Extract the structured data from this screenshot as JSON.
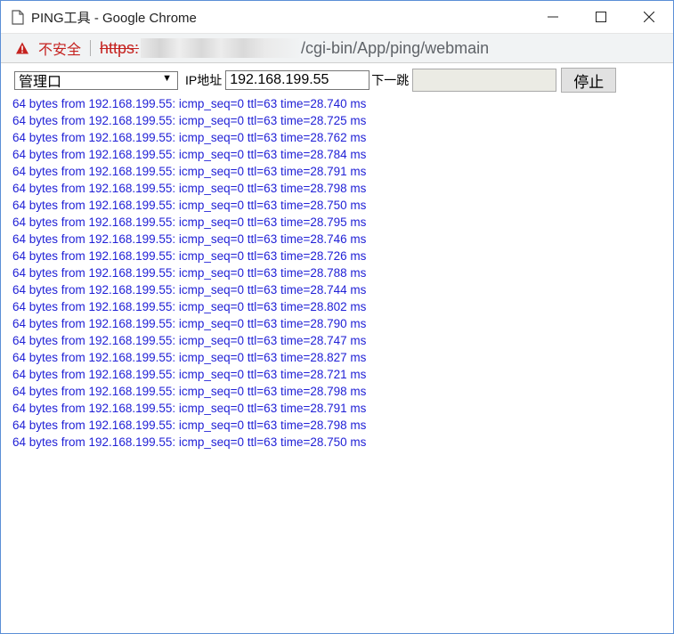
{
  "window": {
    "title": "PING工具 - Google Chrome"
  },
  "address_bar": {
    "security_label": "不安全",
    "url_scheme": "https:",
    "url_path": "/cgi-bin/App/ping/webmain"
  },
  "form": {
    "interface_selected": "管理口",
    "ip_label": "IP地址",
    "ip_value": "192.168.199.55",
    "next_hop_label": "下一跳",
    "next_hop_value": "",
    "stop_label": "停止"
  },
  "output_lines": [
    "64 bytes from 192.168.199.55: icmp_seq=0 ttl=63 time=28.740 ms",
    "64 bytes from 192.168.199.55: icmp_seq=0 ttl=63 time=28.725 ms",
    "64 bytes from 192.168.199.55: icmp_seq=0 ttl=63 time=28.762 ms",
    "64 bytes from 192.168.199.55: icmp_seq=0 ttl=63 time=28.784 ms",
    "64 bytes from 192.168.199.55: icmp_seq=0 ttl=63 time=28.791 ms",
    "64 bytes from 192.168.199.55: icmp_seq=0 ttl=63 time=28.798 ms",
    "64 bytes from 192.168.199.55: icmp_seq=0 ttl=63 time=28.750 ms",
    "64 bytes from 192.168.199.55: icmp_seq=0 ttl=63 time=28.795 ms",
    "64 bytes from 192.168.199.55: icmp_seq=0 ttl=63 time=28.746 ms",
    "64 bytes from 192.168.199.55: icmp_seq=0 ttl=63 time=28.726 ms",
    "64 bytes from 192.168.199.55: icmp_seq=0 ttl=63 time=28.788 ms",
    "64 bytes from 192.168.199.55: icmp_seq=0 ttl=63 time=28.744 ms",
    "64 bytes from 192.168.199.55: icmp_seq=0 ttl=63 time=28.802 ms",
    "64 bytes from 192.168.199.55: icmp_seq=0 ttl=63 time=28.790 ms",
    "64 bytes from 192.168.199.55: icmp_seq=0 ttl=63 time=28.747 ms",
    "64 bytes from 192.168.199.55: icmp_seq=0 ttl=63 time=28.827 ms",
    "64 bytes from 192.168.199.55: icmp_seq=0 ttl=63 time=28.721 ms",
    "64 bytes from 192.168.199.55: icmp_seq=0 ttl=63 time=28.798 ms",
    "64 bytes from 192.168.199.55: icmp_seq=0 ttl=63 time=28.791 ms",
    "64 bytes from 192.168.199.55: icmp_seq=0 ttl=63 time=28.798 ms",
    "64 bytes from 192.168.199.55: icmp_seq=0 ttl=63 time=28.750 ms"
  ],
  "icons": {
    "page": "document-icon",
    "warning": "warning-triangle-icon",
    "minimize": "minimize-icon",
    "maximize": "maximize-icon",
    "close": "close-icon",
    "dropdown": "dropdown-arrow-icon"
  },
  "colors": {
    "insecure": "#c5221f",
    "output_text": "#1f1fd6",
    "window_border": "#5b8fd6"
  }
}
